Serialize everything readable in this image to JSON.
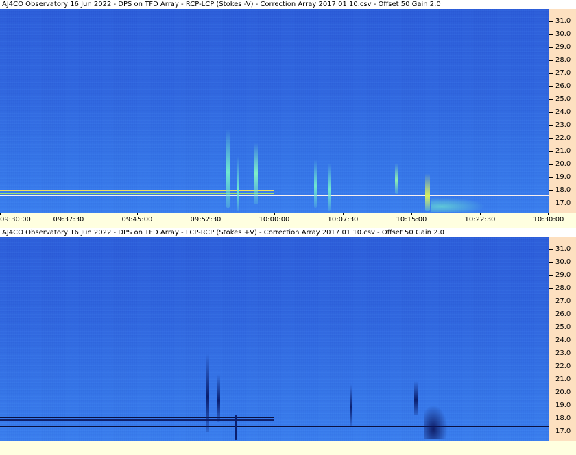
{
  "panels": [
    {
      "title": "AJ4CO Observatory 16 Jun 2022  -  DPS on TFD Array  -  RCP-LCP (Stokes -V)  -  Correction Array 2017 01 10.csv  -  Offset 50  Gain 2.0",
      "y_ticks": [
        "31.0",
        "30.0",
        "29.0",
        "28.0",
        "27.0",
        "26.0",
        "25.0",
        "24.0",
        "23.0",
        "22.0",
        "21.0",
        "20.0",
        "19.0",
        "18.0",
        "17.0"
      ],
      "x_ticks": [
        "09:30:00",
        "09:37:30",
        "09:45:00",
        "09:52:30",
        "10:00:00",
        "10:07:30",
        "10:15:00",
        "10:22:30",
        "10:30:00"
      ],
      "colors": {
        "background": "#2d5fd8",
        "speckle": "#3f8cf0",
        "burst": "#6fe8d0",
        "band": "#f0e060"
      }
    },
    {
      "title": "AJ4CO Observatory 16 Jun 2022  -  DPS on TFD Array  -  LCP-RCP (Stokes +V)  -  Correction Array 2017 01 10.csv  -  Offset 50  Gain 2.0",
      "y_ticks": [
        "31.0",
        "30.0",
        "29.0",
        "28.0",
        "27.0",
        "26.0",
        "25.0",
        "24.0",
        "23.0",
        "22.0",
        "21.0",
        "20.0",
        "19.0",
        "18.0",
        "17.0"
      ],
      "colors": {
        "background": "#2d5fd8",
        "speckle": "#3f8cf0",
        "burst": "#0a1e6e",
        "band": "#0a1040"
      }
    }
  ],
  "y_axis_color": "#fde0c0",
  "x_axis_color": "#ffffe0"
}
